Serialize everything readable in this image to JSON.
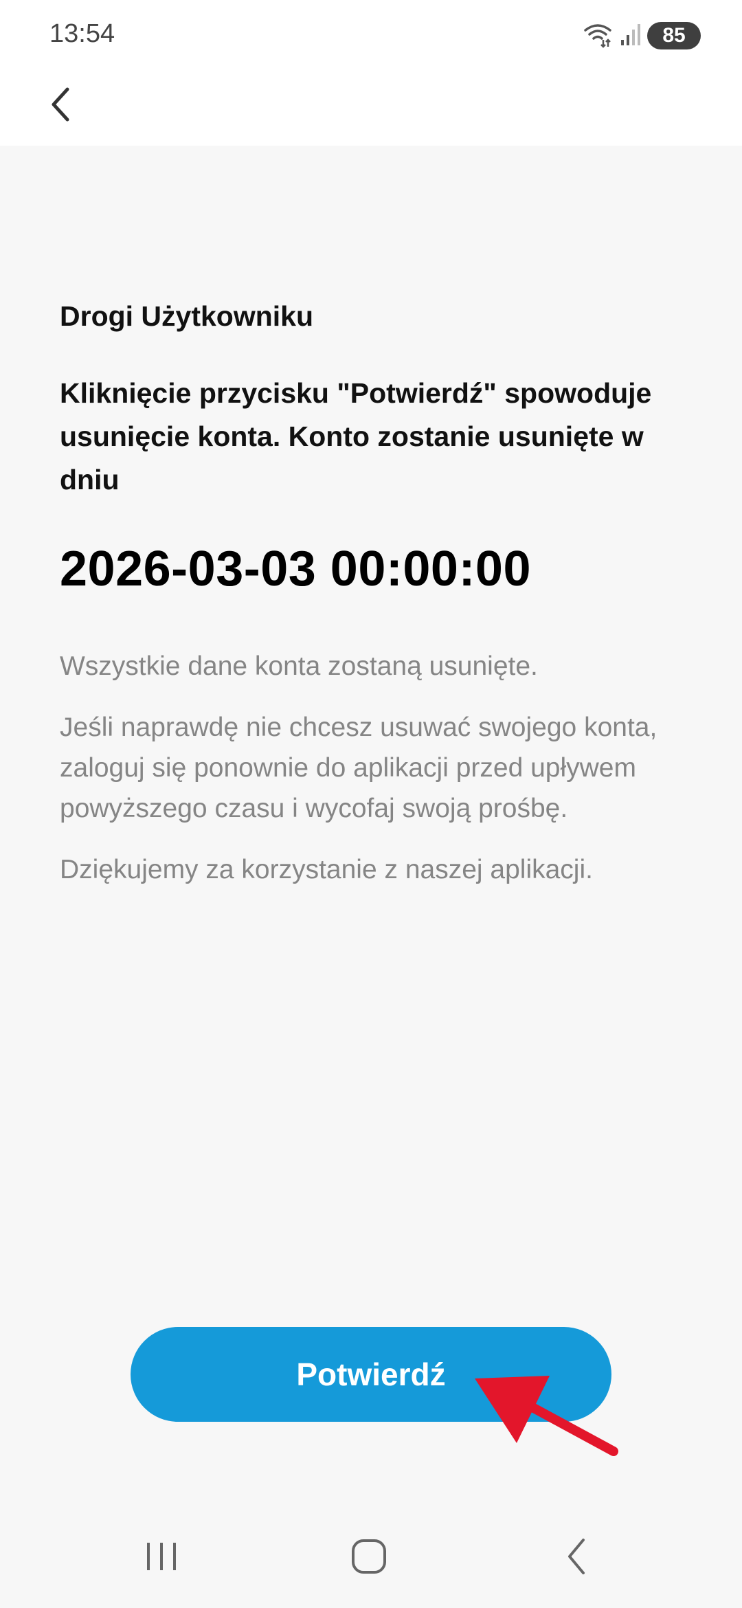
{
  "status_bar": {
    "time": "13:54",
    "battery": "85",
    "icons": [
      "wifi-icon",
      "signal-icon",
      "battery-icon"
    ]
  },
  "app_bar": {
    "back_icon": "chevron-left-icon"
  },
  "content": {
    "greeting": "Drogi Użytkowniku",
    "warning": "Kliknięcie przycisku \"Potwierdź\" spowoduje usunięcie konta. Konto zostanie usunięte w dniu",
    "delete_date": "2026-03-03 00:00:00",
    "info_1": "Wszystkie dane konta zostaną usunięte.",
    "info_2": "Jeśli naprawdę nie chcesz usuwać swojego konta, zaloguj się ponownie do aplikacji przed upływem powyższego czasu i wycofaj swoją prośbę.",
    "info_3": "Dziękujemy za korzystanie z naszej aplikacji."
  },
  "confirm_button": {
    "label": "Potwierdź"
  },
  "colors": {
    "accent": "#159ad9",
    "annotation": "#e3162b",
    "background": "#f7f7f7"
  },
  "nav_bar": {
    "icons": [
      "recent-apps-icon",
      "home-icon",
      "back-icon"
    ]
  }
}
